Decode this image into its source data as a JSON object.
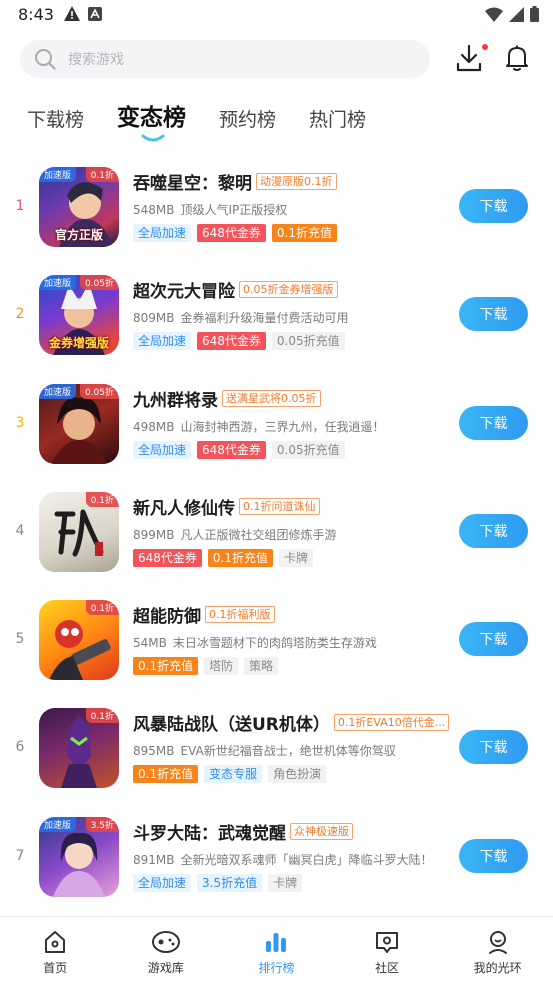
{
  "status_bar": {
    "time": "8:43"
  },
  "search": {
    "placeholder": "搜索游戏"
  },
  "tabs": [
    {
      "label": "下载榜"
    },
    {
      "label": "变态榜"
    },
    {
      "label": "预约榜"
    },
    {
      "label": "热门榜"
    }
  ],
  "active_tab": "变态榜",
  "games": [
    {
      "rank": "1",
      "title": "吞噬星空：黎明",
      "badge": "动漫原版0.1折",
      "size": "548MB",
      "desc": "顶级人气IP正版授权",
      "icon_tag_left": "加速版",
      "icon_tag_right": "0.1折",
      "icon_caption": "官方正版",
      "tags": [
        {
          "text": "全局加速"
        },
        {
          "text": "648代金券"
        },
        {
          "text": "0.1折充值"
        }
      ],
      "button": "下载"
    },
    {
      "rank": "2",
      "title": "超次元大冒险",
      "badge": "0.05折金券增强版",
      "size": "809MB",
      "desc": "金券福利升级海量付费活动可用",
      "icon_tag_left": "加速版",
      "icon_tag_right": "0.05折",
      "icon_caption": "金券增强版",
      "tags": [
        {
          "text": "全局加速"
        },
        {
          "text": "648代金券"
        },
        {
          "text": "0.05折充值"
        }
      ],
      "button": "下载"
    },
    {
      "rank": "3",
      "title": "九州群将录",
      "badge": "送满星武将0.05折",
      "size": "498MB",
      "desc": "山海封神西游，三界九州，任我逍遥！",
      "icon_tag_left": "加速版",
      "icon_tag_right": "0.05折",
      "icon_caption": "",
      "tags": [
        {
          "text": "全局加速"
        },
        {
          "text": "648代金券"
        },
        {
          "text": "0.05折充值"
        }
      ],
      "button": "下载"
    },
    {
      "rank": "4",
      "title": "新凡人修仙传",
      "badge": "0.1折问道诛仙",
      "size": "899MB",
      "desc": "凡人正版微社交组团修炼手游",
      "icon_tag_left": "",
      "icon_tag_right": "0.1折",
      "icon_caption": "",
      "tags": [
        {
          "text": "648代金券"
        },
        {
          "text": "0.1折充值"
        },
        {
          "text": "卡牌"
        }
      ],
      "button": "下载"
    },
    {
      "rank": "5",
      "title": "超能防御",
      "badge": "0.1折福利版",
      "size": "54MB",
      "desc": "末日冰雪题材下的肉鸽塔防类生存游戏",
      "icon_tag_left": "",
      "icon_tag_right": "0.1折",
      "icon_caption": "",
      "tags": [
        {
          "text": "0.1折充值"
        },
        {
          "text": "塔防"
        },
        {
          "text": "策略"
        }
      ],
      "button": "下载"
    },
    {
      "rank": "6",
      "title": "风暴陆战队（送UR机体）",
      "badge": "0.1折EVA10倍代金...",
      "size": "895MB",
      "desc": "EVA新世纪福音战士，绝世机体等你驾驭",
      "icon_tag_left": "",
      "icon_tag_right": "0.1折",
      "icon_caption": "",
      "tags": [
        {
          "text": "0.1折充值"
        },
        {
          "text": "变态专服"
        },
        {
          "text": "角色扮演"
        }
      ],
      "button": "下载"
    },
    {
      "rank": "7",
      "title": "斗罗大陆：武魂觉醒",
      "badge": "众神极速版",
      "size": "891MB",
      "desc": "全新光暗双系魂师「幽冥白虎」降临斗罗大陆！",
      "icon_tag_left": "加速版",
      "icon_tag_right": "3.5折",
      "icon_caption": "",
      "tags": [
        {
          "text": "全局加速"
        },
        {
          "text": "3.5折充值"
        },
        {
          "text": "卡牌"
        }
      ],
      "button": "下载"
    }
  ],
  "bottom_nav": [
    {
      "label": "首页",
      "icon": "home-icon"
    },
    {
      "label": "游戏库",
      "icon": "gamepad-icon"
    },
    {
      "label": "排行榜",
      "icon": "ranking-icon"
    },
    {
      "label": "社区",
      "icon": "community-icon"
    },
    {
      "label": "我的光环",
      "icon": "profile-icon"
    }
  ],
  "active_nav": "排行榜",
  "colors": {
    "accent": "#2f9af0",
    "tag_red": "#f3535b",
    "tag_orange": "#f88419",
    "tag_blue_text": "#2f8ff0",
    "badge_orange": "#f07a2a"
  }
}
